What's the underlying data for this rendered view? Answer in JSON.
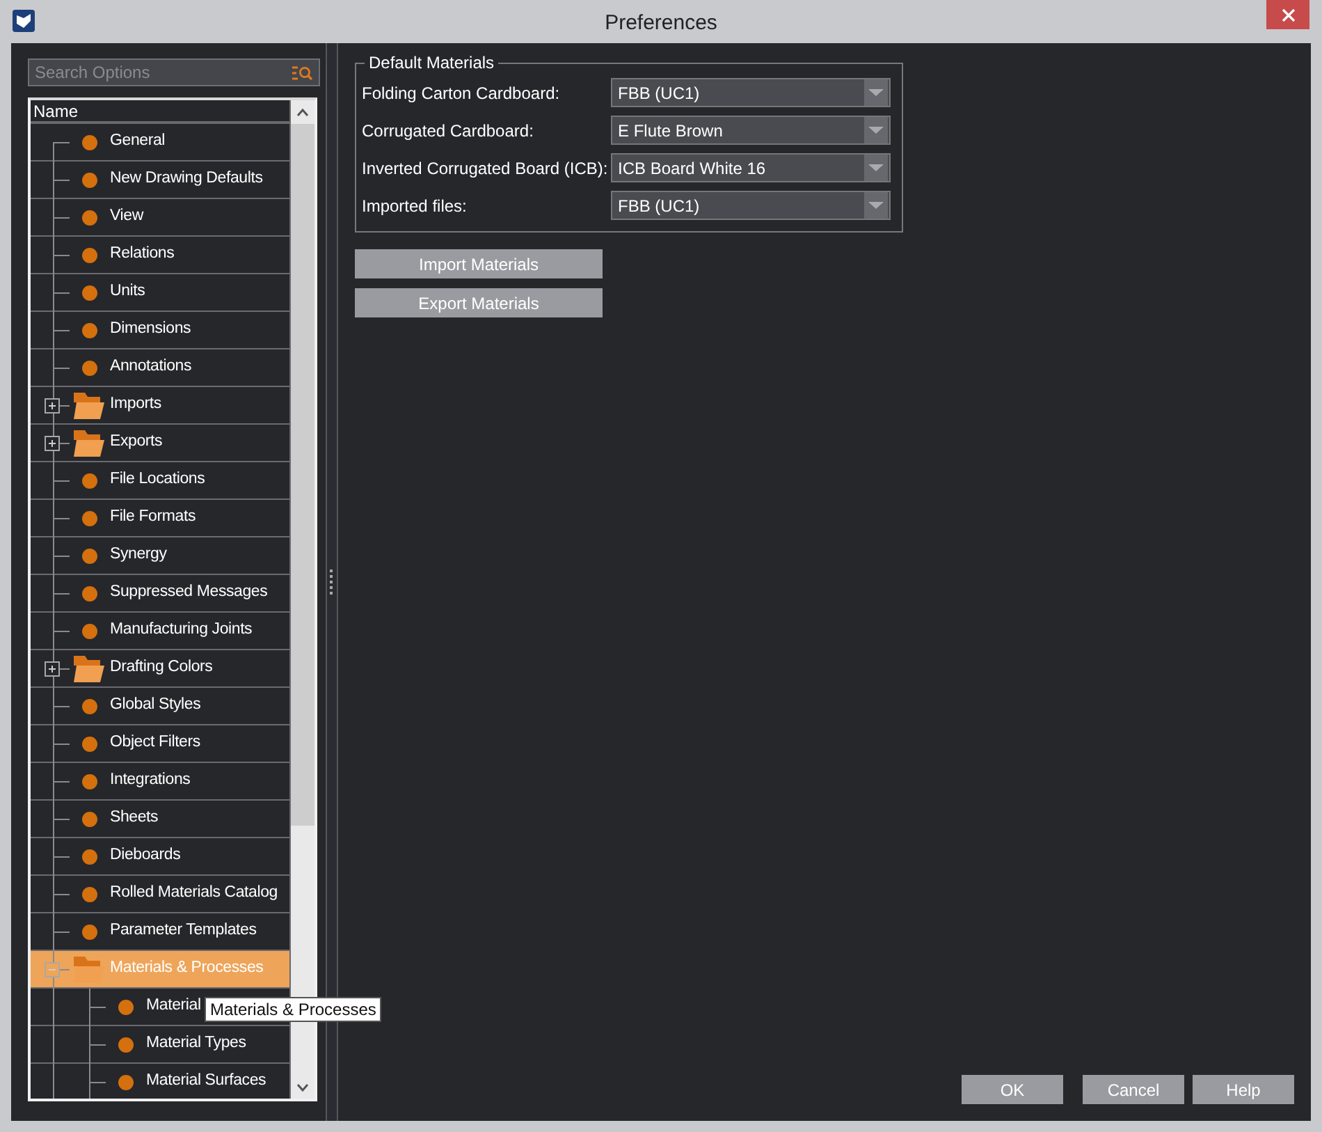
{
  "window": {
    "title": "Preferences"
  },
  "search": {
    "placeholder": "Search Options"
  },
  "tree": {
    "column": "Name",
    "items": [
      {
        "label": "General",
        "kind": "leaf",
        "selected": false
      },
      {
        "label": "New Drawing Defaults",
        "kind": "leaf",
        "selected": false
      },
      {
        "label": "View",
        "kind": "leaf",
        "selected": false
      },
      {
        "label": "Relations",
        "kind": "leaf",
        "selected": false
      },
      {
        "label": "Units",
        "kind": "leaf",
        "selected": false
      },
      {
        "label": "Dimensions",
        "kind": "leaf",
        "selected": false
      },
      {
        "label": "Annotations",
        "kind": "leaf",
        "selected": false
      },
      {
        "label": "Imports",
        "kind": "folder",
        "expanded": false,
        "selected": false
      },
      {
        "label": "Exports",
        "kind": "folder",
        "expanded": false,
        "selected": false
      },
      {
        "label": "File Locations",
        "kind": "leaf",
        "selected": false
      },
      {
        "label": "File Formats",
        "kind": "leaf",
        "selected": false
      },
      {
        "label": "Synergy",
        "kind": "leaf",
        "selected": false
      },
      {
        "label": "Suppressed Messages",
        "kind": "leaf",
        "selected": false
      },
      {
        "label": "Manufacturing Joints",
        "kind": "leaf",
        "selected": false
      },
      {
        "label": "Drafting Colors",
        "kind": "folder",
        "expanded": false,
        "selected": false
      },
      {
        "label": "Global Styles",
        "kind": "leaf",
        "selected": false
      },
      {
        "label": "Object Filters",
        "kind": "leaf",
        "selected": false
      },
      {
        "label": "Integrations",
        "kind": "leaf",
        "selected": false
      },
      {
        "label": "Sheets",
        "kind": "leaf",
        "selected": false
      },
      {
        "label": "Dieboards",
        "kind": "leaf",
        "selected": false
      },
      {
        "label": "Rolled Materials Catalog",
        "kind": "leaf",
        "selected": false
      },
      {
        "label": "Parameter Templates",
        "kind": "leaf",
        "selected": false
      },
      {
        "label": "Materials & Processes",
        "kind": "folder",
        "expanded": true,
        "selected": true,
        "children": [
          {
            "label": "Material",
            "kind": "leaf",
            "selected": false
          },
          {
            "label": "Material Types",
            "kind": "leaf",
            "selected": false
          },
          {
            "label": "Material Surfaces",
            "kind": "leaf",
            "selected": false
          }
        ]
      }
    ]
  },
  "tooltip": "Materials & Processes",
  "default_materials": {
    "title": "Default Materials",
    "fields": [
      {
        "label": "Folding Carton Cardboard:",
        "value": "FBB (UC1)"
      },
      {
        "label": "Corrugated Cardboard:",
        "value": "E Flute Brown"
      },
      {
        "label": "Inverted Corrugated Board (ICB):",
        "value": "ICB Board White 16"
      },
      {
        "label": "Imported files:",
        "value": "FBB (UC1)"
      }
    ]
  },
  "material_buttons": [
    "Import Materials",
    "Export Materials"
  ],
  "dialog_buttons": [
    "OK",
    "Cancel",
    "Help"
  ]
}
